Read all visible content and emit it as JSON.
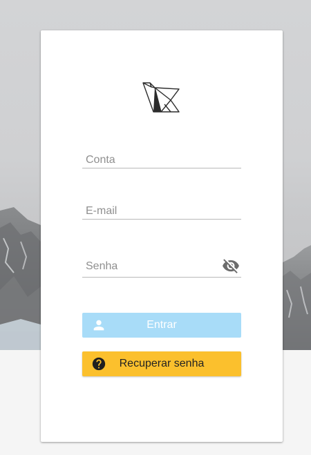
{
  "form": {
    "conta_placeholder": "Conta",
    "email_placeholder": "E-mail",
    "senha_placeholder": "Senha"
  },
  "buttons": {
    "entrar_label": "Entrar",
    "recuperar_label": "Recuperar senha"
  },
  "icons": {
    "logo": "origami-bird-logo",
    "password_toggle": "eye-off-icon",
    "entrar": "person-icon",
    "recuperar": "help-circle-icon"
  },
  "colors": {
    "entrar_button": "#a8dcf8",
    "recuperar_button": "#fbc02d"
  }
}
